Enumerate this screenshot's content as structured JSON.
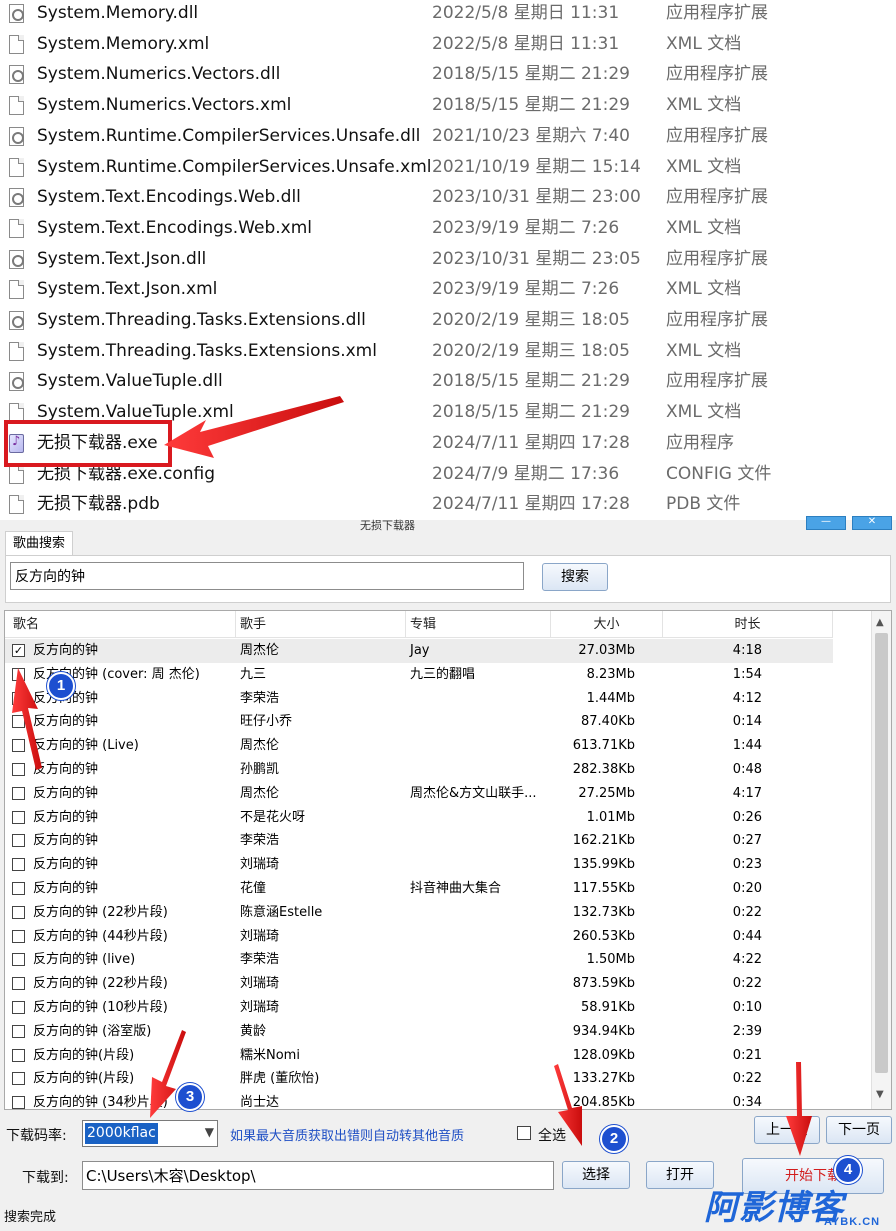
{
  "explorer": {
    "files": [
      {
        "name": "System.Memory.dll",
        "date": "2022/5/8 星期日 11:31",
        "type": "应用程序扩展",
        "icon": "dll"
      },
      {
        "name": "System.Memory.xml",
        "date": "2022/5/8 星期日 11:31",
        "type": "XML 文档",
        "icon": "xml"
      },
      {
        "name": "System.Numerics.Vectors.dll",
        "date": "2018/5/15 星期二 21:29",
        "type": "应用程序扩展",
        "icon": "dll"
      },
      {
        "name": "System.Numerics.Vectors.xml",
        "date": "2018/5/15 星期二 21:29",
        "type": "XML 文档",
        "icon": "xml"
      },
      {
        "name": "System.Runtime.CompilerServices.Unsafe.dll",
        "date": "2021/10/23 星期六 7:40",
        "type": "应用程序扩展",
        "icon": "dll"
      },
      {
        "name": "System.Runtime.CompilerServices.Unsafe.xml",
        "date": "2021/10/19 星期二 15:14",
        "type": "XML 文档",
        "icon": "xml"
      },
      {
        "name": "System.Text.Encodings.Web.dll",
        "date": "2023/10/31 星期二 23:00",
        "type": "应用程序扩展",
        "icon": "dll"
      },
      {
        "name": "System.Text.Encodings.Web.xml",
        "date": "2023/9/19 星期二 7:26",
        "type": "XML 文档",
        "icon": "xml"
      },
      {
        "name": "System.Text.Json.dll",
        "date": "2023/10/31 星期二 23:05",
        "type": "应用程序扩展",
        "icon": "dll"
      },
      {
        "name": "System.Text.Json.xml",
        "date": "2023/9/19 星期二 7:26",
        "type": "XML 文档",
        "icon": "xml"
      },
      {
        "name": "System.Threading.Tasks.Extensions.dll",
        "date": "2020/2/19 星期三 18:05",
        "type": "应用程序扩展",
        "icon": "dll"
      },
      {
        "name": "System.Threading.Tasks.Extensions.xml",
        "date": "2020/2/19 星期三 18:05",
        "type": "XML 文档",
        "icon": "xml"
      },
      {
        "name": "System.ValueTuple.dll",
        "date": "2018/5/15 星期二 21:29",
        "type": "应用程序扩展",
        "icon": "dll"
      },
      {
        "name": "System.ValueTuple.xml",
        "date": "2018/5/15 星期二 21:29",
        "type": "XML 文档",
        "icon": "xml"
      },
      {
        "name": "无损下载器.exe",
        "date": "2024/7/11 星期四 17:28",
        "type": "应用程序",
        "icon": "exe"
      },
      {
        "name": "无损下载器.exe.config",
        "date": "2024/7/9 星期二 17:36",
        "type": "CONFIG 文件",
        "icon": "xml"
      },
      {
        "name": "无损下载器.pdb",
        "date": "2024/7/11 星期四 17:28",
        "type": "PDB 文件",
        "icon": "xml"
      }
    ]
  },
  "app": {
    "title": "无损下载器",
    "minimize_label": "—",
    "close_label": "✕",
    "search_tab": "歌曲搜索",
    "search_value": "反方向的钟",
    "search_button": "搜索",
    "columns": {
      "name": "歌名",
      "artist": "歌手",
      "album": "专辑",
      "size": "大小",
      "duration": "时长"
    },
    "songs": [
      {
        "checked": true,
        "name": "反方向的钟",
        "artist": "周杰伦",
        "album": "Jay",
        "size": "27.03Mb",
        "duration": "4:18"
      },
      {
        "checked": false,
        "name": "反方向的钟 (cover: 周 杰伦)",
        "artist": "九三",
        "album": "九三的翻唱",
        "size": "8.23Mb",
        "duration": "1:54"
      },
      {
        "checked": false,
        "name": "反方向的钟",
        "artist": "李荣浩",
        "album": "",
        "size": "1.44Mb",
        "duration": "4:12"
      },
      {
        "checked": false,
        "name": "反方向的钟",
        "artist": "旺仔小乔",
        "album": "",
        "size": "87.40Kb",
        "duration": "0:14"
      },
      {
        "checked": false,
        "name": "反方向的钟 (Live)",
        "artist": "周杰伦",
        "album": "",
        "size": "613.71Kb",
        "duration": "1:44"
      },
      {
        "checked": false,
        "name": "反方向的钟",
        "artist": "孙鹏凯",
        "album": "",
        "size": "282.38Kb",
        "duration": "0:48"
      },
      {
        "checked": false,
        "name": "反方向的钟",
        "artist": "周杰伦",
        "album": "周杰伦&方文山联手...",
        "size": "27.25Mb",
        "duration": "4:17"
      },
      {
        "checked": false,
        "name": "反方向的钟",
        "artist": "不是花火呀",
        "album": "",
        "size": "1.01Mb",
        "duration": "0:26"
      },
      {
        "checked": false,
        "name": "反方向的钟",
        "artist": "李荣浩",
        "album": "",
        "size": "162.21Kb",
        "duration": "0:27"
      },
      {
        "checked": false,
        "name": "反方向的钟",
        "artist": "刘瑞琦",
        "album": "",
        "size": "135.99Kb",
        "duration": "0:23"
      },
      {
        "checked": false,
        "name": "反方向的钟",
        "artist": "花僮",
        "album": "抖音神曲大集合",
        "size": "117.55Kb",
        "duration": "0:20"
      },
      {
        "checked": false,
        "name": "反方向的钟 (22秒片段)",
        "artist": "陈意涵Estelle",
        "album": "",
        "size": "132.73Kb",
        "duration": "0:22"
      },
      {
        "checked": false,
        "name": "反方向的钟 (44秒片段)",
        "artist": "刘瑞琦",
        "album": "",
        "size": "260.53Kb",
        "duration": "0:44"
      },
      {
        "checked": false,
        "name": "反方向的钟 (live)",
        "artist": "李荣浩",
        "album": "",
        "size": "1.50Mb",
        "duration": "4:22"
      },
      {
        "checked": false,
        "name": "反方向的钟 (22秒片段)",
        "artist": "刘瑞琦",
        "album": "",
        "size": "873.59Kb",
        "duration": "0:22"
      },
      {
        "checked": false,
        "name": "反方向的钟 (10秒片段)",
        "artist": "刘瑞琦",
        "album": "",
        "size": "58.91Kb",
        "duration": "0:10"
      },
      {
        "checked": false,
        "name": "反方向的钟 (浴室版)",
        "artist": "黄龄",
        "album": "",
        "size": "934.94Kb",
        "duration": "2:39"
      },
      {
        "checked": false,
        "name": "反方向的钟(片段)",
        "artist": "糯米Nomi",
        "album": "",
        "size": "128.09Kb",
        "duration": "0:21"
      },
      {
        "checked": false,
        "name": "反方向的钟(片段)",
        "artist": "胖虎 (董欣怡)",
        "album": "",
        "size": "133.27Kb",
        "duration": "0:22"
      },
      {
        "checked": false,
        "name": "反方向的钟 (34秒片段)",
        "artist": "尚士达",
        "album": "",
        "size": "204.85Kb",
        "duration": "0:34"
      }
    ],
    "quality_label": "下载码率:",
    "quality_value": "2000kflac",
    "quality_hint": "如果最大音质获取出错则自动转其他音质",
    "select_all_label": "全选",
    "prev_button": "上一页",
    "next_button": "下一页",
    "path_label": "下载到:",
    "path_value": "C:\\Users\\木容\\Desktop\\",
    "browse_button": "选择",
    "open_button": "打开",
    "start_button": "开始下载",
    "status": "搜索完成"
  },
  "annotations": {
    "badges": [
      "1",
      "2",
      "3",
      "4"
    ],
    "highlight_color": "#d9191f",
    "badge_color": "#1d4fd0"
  },
  "watermark": {
    "main": "阿影博客",
    "sub": "AYBK.CN"
  }
}
